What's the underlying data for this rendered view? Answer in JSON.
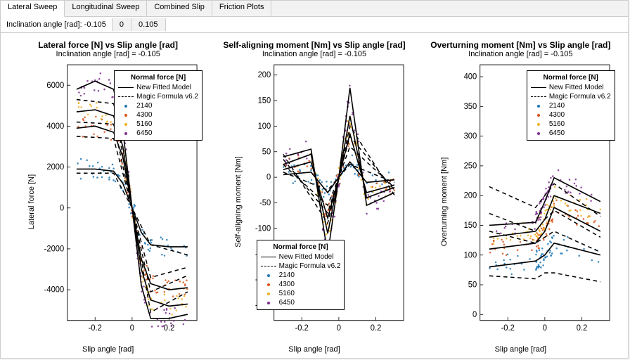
{
  "tabs": [
    "Lateral Sweep",
    "Longitudinal Sweep",
    "Combined Slip",
    "Friction Plots"
  ],
  "active_tab": 0,
  "subbar": {
    "label": "Inclination angle [rad]: -0.105",
    "options": [
      "0",
      "0.105"
    ]
  },
  "legend": {
    "title": "Normal force [N]",
    "entries": [
      {
        "type": "solid",
        "label": "New Fitted Model"
      },
      {
        "type": "dash",
        "label": "Magic Formula v6.2"
      },
      {
        "type": "dot",
        "color": "#1f77b4",
        "label": "2140"
      },
      {
        "type": "dot",
        "color": "#d95319",
        "label": "4300"
      },
      {
        "type": "dot",
        "color": "#edb120",
        "label": "5160"
      },
      {
        "type": "dot",
        "color": "#7e2f8e",
        "label": "6450"
      }
    ]
  },
  "charts": [
    {
      "title": "Lateral force [N] vs Slip angle [rad]",
      "subtitle": "Inclination angle [rad] = -0.105",
      "xlabel": "Slip angle [rad]",
      "ylabel": "Lateral force [N]",
      "xticks": [
        -0.2,
        0,
        0.2
      ],
      "yticks": [
        -4000,
        -2000,
        0,
        2000,
        4000,
        6000
      ],
      "xlim": [
        -0.35,
        0.35
      ],
      "ylim": [
        -5500,
        7000
      ],
      "legend_pos": {
        "top": 15,
        "right": -2
      }
    },
    {
      "title": "Self-aligning moment [Nm] vs Slip angle [rad]",
      "subtitle": "Inclination angle [rad] = -0.105",
      "xlabel": "Slip angle [rad]",
      "ylabel": "Self-aligning moment [Nm]",
      "xticks": [
        -0.2,
        0,
        0.2
      ],
      "yticks": [
        -250,
        -200,
        -150,
        -100,
        -50,
        0,
        50,
        100,
        150,
        200
      ],
      "xlim": [
        -0.35,
        0.35
      ],
      "ylim": [
        -280,
        220
      ],
      "legend_pos": {
        "bottom": 48,
        "left": 20
      }
    },
    {
      "title": "Overturning moment [Nm] vs Slip angle [rad]",
      "subtitle": "Inclination angle [rad] = -0.105",
      "xlabel": "Slip angle [rad]",
      "ylabel": "Overturning moment [Nm]",
      "xticks": [
        -0.2,
        0,
        0.2
      ],
      "yticks": [
        0,
        50,
        100,
        150,
        200,
        250,
        300,
        350,
        400
      ],
      "xlim": [
        -0.35,
        0.35
      ],
      "ylim": [
        -10,
        420
      ],
      "legend_pos": {
        "top": 15,
        "right": -2
      }
    }
  ],
  "chart_data": [
    {
      "type": "line+scatter",
      "title": "Lateral force [N] vs Slip angle [rad]",
      "xlabel": "Slip angle [rad]",
      "ylabel": "Lateral force [N]",
      "xlim": [
        -0.35,
        0.35
      ],
      "ylim": [
        -5500,
        7000
      ],
      "series": [
        {
          "name": "New Fitted Model 2140",
          "style": "solid",
          "x": [
            -0.3,
            -0.2,
            -0.1,
            -0.05,
            0,
            0.05,
            0.1,
            0.2,
            0.3
          ],
          "y": [
            1900,
            1900,
            1800,
            1200,
            0,
            -1200,
            -1800,
            -1900,
            -1900
          ]
        },
        {
          "name": "New Fitted Model 4300",
          "style": "solid",
          "x": [
            -0.3,
            -0.2,
            -0.1,
            -0.05,
            0,
            0.05,
            0.1,
            0.2,
            0.3
          ],
          "y": [
            3900,
            4000,
            3700,
            2500,
            0,
            -2500,
            -3700,
            -4000,
            -3900
          ]
        },
        {
          "name": "New Fitted Model 5160",
          "style": "solid",
          "x": [
            -0.3,
            -0.2,
            -0.1,
            -0.05,
            0,
            0.05,
            0.1,
            0.2,
            0.3
          ],
          "y": [
            4700,
            4800,
            4500,
            3000,
            0,
            -3000,
            -4500,
            -4800,
            -4700
          ]
        },
        {
          "name": "New Fitted Model 6450",
          "style": "solid",
          "x": [
            -0.3,
            -0.2,
            -0.1,
            -0.05,
            0,
            0.05,
            0.1,
            0.2,
            0.3
          ],
          "y": [
            5800,
            6200,
            5800,
            3800,
            0,
            -3800,
            -5400,
            -5400,
            -5200
          ]
        },
        {
          "name": "Magic Formula v6.2 2140",
          "style": "dash",
          "x": [
            -0.3,
            -0.1,
            0,
            0.1,
            0.3
          ],
          "y": [
            1700,
            1700,
            0,
            -1800,
            -2300
          ]
        },
        {
          "name": "Magic Formula v6.2 4300",
          "style": "dash",
          "x": [
            -0.3,
            -0.1,
            0,
            0.1,
            0.3
          ],
          "y": [
            3500,
            3400,
            0,
            -3400,
            -2900
          ]
        },
        {
          "name": "Magic Formula v6.2 5160",
          "style": "dash",
          "x": [
            -0.3,
            -0.1,
            0,
            0.1,
            0.3
          ],
          "y": [
            4200,
            4100,
            0,
            -4100,
            -3300
          ]
        },
        {
          "name": "Magic Formula v6.2 6450",
          "style": "dash",
          "x": [
            -0.3,
            -0.1,
            0,
            0.1,
            0.3
          ],
          "y": [
            5300,
            5100,
            0,
            -5100,
            -4100
          ]
        }
      ],
      "scatter_loads": [
        2140,
        4300,
        5160,
        6450
      ]
    },
    {
      "type": "line+scatter",
      "title": "Self-aligning moment [Nm] vs Slip angle [rad]",
      "xlabel": "Slip angle [rad]",
      "ylabel": "Self-aligning moment [Nm]",
      "xlim": [
        -0.35,
        0.35
      ],
      "ylim": [
        -280,
        220
      ],
      "series": [
        {
          "name": "New Fitted Model 2140",
          "style": "solid",
          "x": [
            -0.3,
            -0.15,
            -0.06,
            0,
            0.06,
            0.15,
            0.3
          ],
          "y": [
            5,
            10,
            -30,
            0,
            30,
            -10,
            -5
          ]
        },
        {
          "name": "New Fitted Model 4300",
          "style": "solid",
          "x": [
            -0.3,
            -0.15,
            -0.06,
            0,
            0.06,
            0.15,
            0.3
          ],
          "y": [
            15,
            30,
            -80,
            0,
            85,
            -30,
            -15
          ]
        },
        {
          "name": "New Fitted Model 5160",
          "style": "solid",
          "x": [
            -0.3,
            -0.15,
            -0.06,
            0,
            0.06,
            0.15,
            0.3
          ],
          "y": [
            25,
            45,
            -110,
            0,
            120,
            -40,
            -20
          ]
        },
        {
          "name": "New Fitted Model 6450",
          "style": "solid",
          "x": [
            -0.3,
            -0.15,
            -0.06,
            0,
            0.06,
            0.15,
            0.3
          ],
          "y": [
            40,
            55,
            -150,
            0,
            175,
            -55,
            -30
          ]
        },
        {
          "name": "Magic Formula v6.2 2140",
          "style": "dash",
          "x": [
            -0.3,
            -0.06,
            0,
            0.06,
            0.3
          ],
          "y": [
            10,
            -25,
            0,
            25,
            -10
          ]
        },
        {
          "name": "Magic Formula v6.2 4300",
          "style": "dash",
          "x": [
            -0.3,
            -0.06,
            0,
            0.06,
            0.3
          ],
          "y": [
            25,
            -55,
            0,
            60,
            -20
          ]
        },
        {
          "name": "Magic Formula v6.2 5160",
          "style": "dash",
          "x": [
            -0.3,
            -0.06,
            0,
            0.06,
            0.3
          ],
          "y": [
            35,
            -70,
            0,
            80,
            -25
          ]
        },
        {
          "name": "Magic Formula v6.2 6450",
          "style": "dash",
          "x": [
            -0.3,
            -0.06,
            0,
            0.06,
            0.3
          ],
          "y": [
            45,
            -90,
            0,
            100,
            -35
          ]
        }
      ],
      "scatter_loads": [
        2140,
        4300,
        5160,
        6450
      ]
    },
    {
      "type": "line+scatter",
      "title": "Overturning moment [Nm] vs Slip angle [rad]",
      "xlabel": "Slip angle [rad]",
      "ylabel": "Overturning moment [Nm]",
      "xlim": [
        -0.35,
        0.35
      ],
      "ylim": [
        -10,
        420
      ],
      "series": [
        {
          "name": "New Fitted Model 2140",
          "style": "solid",
          "x": [
            -0.3,
            -0.05,
            0,
            0.05,
            0.3
          ],
          "y": [
            80,
            90,
            100,
            120,
            100
          ]
        },
        {
          "name": "New Fitted Model 4300",
          "style": "solid",
          "x": [
            -0.3,
            -0.05,
            0,
            0.05,
            0.3
          ],
          "y": [
            110,
            120,
            140,
            180,
            140
          ]
        },
        {
          "name": "New Fitted Model 5160",
          "style": "solid",
          "x": [
            -0.3,
            -0.05,
            0,
            0.05,
            0.3
          ],
          "y": [
            130,
            140,
            160,
            200,
            170
          ]
        },
        {
          "name": "New Fitted Model 6450",
          "style": "solid",
          "x": [
            -0.3,
            -0.05,
            0,
            0.05,
            0.3
          ],
          "y": [
            150,
            155,
            190,
            230,
            190
          ]
        },
        {
          "name": "Magic Formula v6.2 2140",
          "style": "dash",
          "x": [
            -0.3,
            -0.05,
            0,
            0.05,
            0.3
          ],
          "y": [
            65,
            60,
            70,
            70,
            55
          ]
        },
        {
          "name": "Magic Formula v6.2 4300",
          "style": "dash",
          "x": [
            -0.3,
            -0.05,
            0,
            0.05,
            0.3
          ],
          "y": [
            140,
            120,
            130,
            140,
            105
          ]
        },
        {
          "name": "Magic Formula v6.2 5160",
          "style": "dash",
          "x": [
            -0.3,
            -0.05,
            0,
            0.05,
            0.3
          ],
          "y": [
            170,
            140,
            160,
            175,
            130
          ]
        },
        {
          "name": "Magic Formula v6.2 6450",
          "style": "dash",
          "x": [
            -0.3,
            -0.05,
            0,
            0.05,
            0.3
          ],
          "y": [
            215,
            180,
            200,
            220,
            165
          ]
        }
      ],
      "scatter_loads": [
        2140,
        4300,
        5160,
        6450
      ]
    }
  ]
}
